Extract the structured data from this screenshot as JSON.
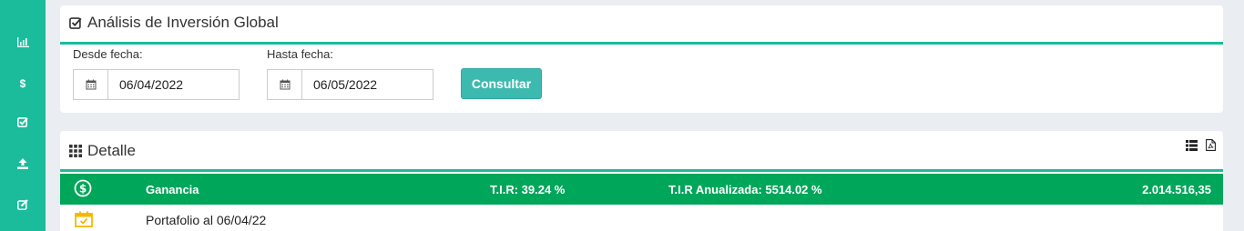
{
  "sidebar": {
    "items": [
      {
        "icon": "bar-chart-icon"
      },
      {
        "icon": "dollar-icon",
        "glyph": "$"
      },
      {
        "icon": "check-square-icon"
      },
      {
        "icon": "upload-icon"
      },
      {
        "icon": "edit-icon"
      }
    ]
  },
  "analysis": {
    "title": "Análisis de Inversión Global",
    "from_label": "Desde fecha:",
    "from_value": "06/04/2022",
    "to_label": "Hasta fecha:",
    "to_value": "06/05/2022",
    "button_label": "Consultar"
  },
  "detail": {
    "title": "Detalle",
    "summary_row": {
      "label": "Ganancia",
      "tir": "T.I.R: 39.24 %",
      "tir_annual": "T.I.R Anualizada: 5514.02 %",
      "amount": "2.014.516,35"
    },
    "portfolio_row": {
      "label": "Portafolio al 06/04/22"
    }
  },
  "colors": {
    "sidebar": "#1abc9c",
    "accent_rule": "#1abc9c",
    "button": "#3dbab0",
    "summary_row": "#00a65a",
    "calendar_icon": "#f5b800"
  }
}
